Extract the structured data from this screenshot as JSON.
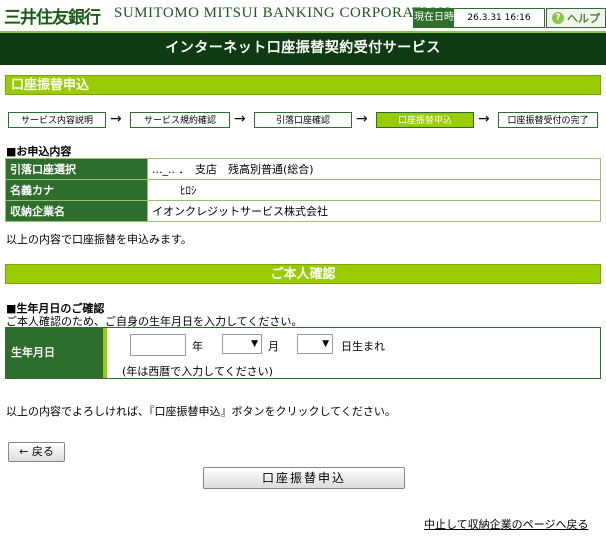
{
  "header": {
    "logo_jp": "三井住友銀行",
    "logo_en": "SUMITOMO MITSUI BANKING CORPORATION",
    "datetime_label": "現在日時",
    "datetime_value": "26.3.31 16:16",
    "help_label": "ヘルプ",
    "help_icon": "question-icon"
  },
  "title": "インターネット口座振替契約受付サービス",
  "section_transfer": "口座振替申込",
  "steps": [
    {
      "label": "サービス内容説明",
      "active": false
    },
    {
      "label": "サービス規約確認",
      "active": false
    },
    {
      "label": "引落口座確認",
      "active": false
    },
    {
      "label": "口座振替申込",
      "active": true
    },
    {
      "label": "口座振替受付の完了",
      "active": false
    }
  ],
  "step_arrow": "→",
  "application": {
    "heading": "■お申込内容",
    "rows": [
      {
        "label": "引落口座選択",
        "value": "..._.. ．　支店　残高別普通(総合)"
      },
      {
        "label": "名義カナ",
        "value": "ﾋﾛｼ"
      },
      {
        "label": "収納企業名",
        "value": "イオンクレジットサービス株式会社"
      }
    ],
    "message": "以上の内容で口座振替を申込みます。"
  },
  "section_confirm": "ご本人確認",
  "dob": {
    "heading": "■生年月日のご確認",
    "instruction": "ご本人確認のため、ご自身の生年月日を入力してください。",
    "label": "生年月日",
    "year_unit": "年",
    "month_unit": "月",
    "day_unit": "日生まれ",
    "note": "(年は西暦で入力してください)",
    "month_arrow": "▼",
    "day_arrow": "▼"
  },
  "bottom_message": "以上の内容でよろしければ、『口座振替申込』ボタンをクリックしてください。",
  "buttons": {
    "back": "← 戻る",
    "submit": "口座振替申込",
    "cancel_link": "中止して収納企業のページへ戻る"
  },
  "colors": {
    "dark_green": "#2d6e2d",
    "title_bg": "#0e3b12",
    "lime": "#99cc00"
  }
}
